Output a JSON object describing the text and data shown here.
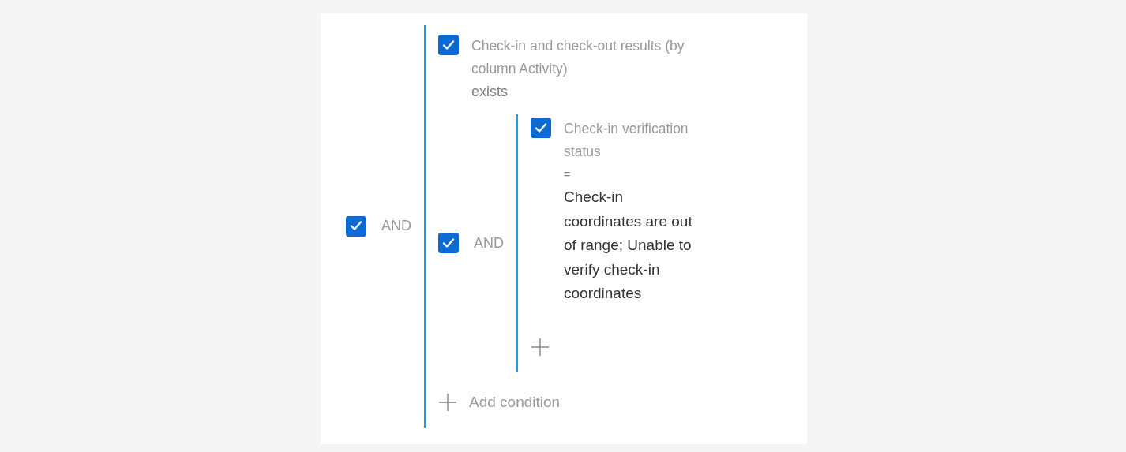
{
  "filter_group": {
    "operator": "AND",
    "checked": true,
    "add_label": "Add condition",
    "items": [
      {
        "kind": "condition",
        "checked": true,
        "column": "Check-in and check-out results (by column Activity)",
        "comparison": "exists"
      },
      {
        "kind": "group",
        "checked": true,
        "operator": "AND",
        "items": [
          {
            "kind": "condition",
            "checked": true,
            "column": "Check-in verification status",
            "comparison": "=",
            "value": "Check-in coordinates are out of range; Unable to verify check-in coordinates"
          }
        ]
      }
    ]
  }
}
